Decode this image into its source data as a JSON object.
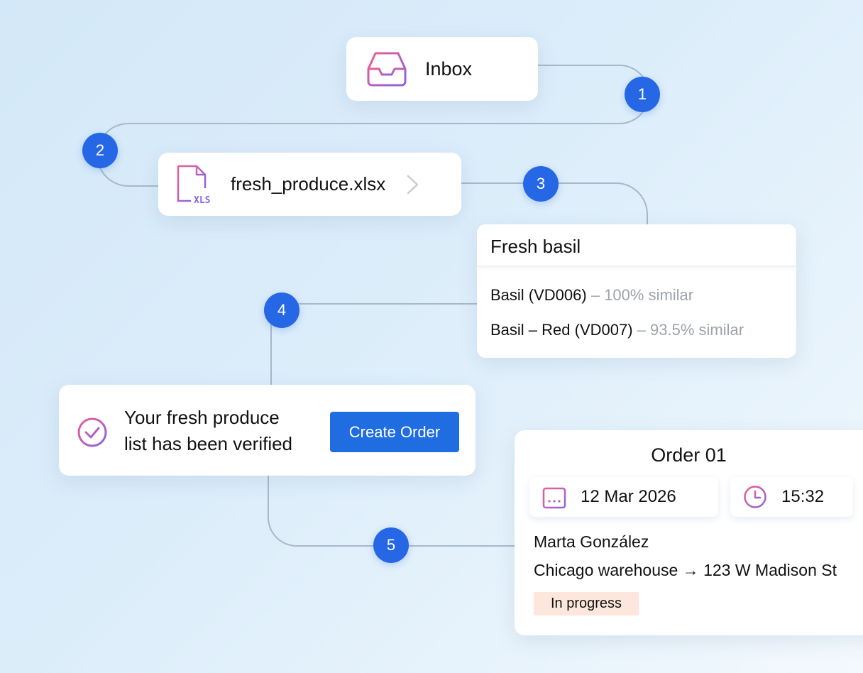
{
  "steps": [
    "1",
    "2",
    "3",
    "4",
    "5"
  ],
  "inbox": {
    "title": "Inbox",
    "icon": "inbox-icon"
  },
  "file": {
    "name": "fresh_produce.xlsx",
    "icon": "xls-file-icon",
    "icon_text": "XLS"
  },
  "search": {
    "query": "Fresh basil",
    "results": [
      {
        "name": "Basil (VD006)",
        "similarity": "– 100% similar"
      },
      {
        "name": "Basil – Red (VD007)",
        "similarity": "– 93.5% similar"
      }
    ]
  },
  "verification": {
    "line1": "Your fresh produce",
    "line2": "list has been verified",
    "button": "Create  Order",
    "icon": "check-circle-icon"
  },
  "order": {
    "title": "Order 01",
    "date": "12 Mar 2026",
    "time": "15:32",
    "person": "Marta González",
    "route": "Chicago warehouse  → 123 W Madison St",
    "status": "In progress"
  },
  "colors": {
    "step": "#2667e6",
    "button": "#1f6de0",
    "badge_bg": "#fde6dc",
    "icon_gradient": [
      "#ec5f8e",
      "#8a63e6"
    ],
    "connector": "#a9b8c7"
  }
}
